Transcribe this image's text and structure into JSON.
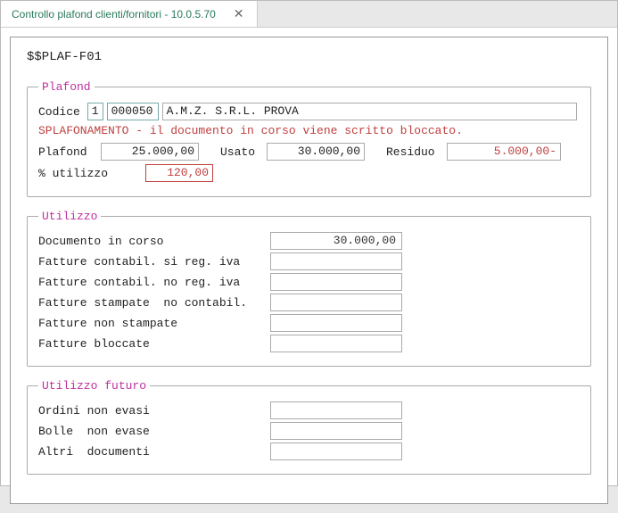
{
  "tab": {
    "title": "Controllo plafond clienti/fornitori   -   10.0.5.70",
    "close": "✕"
  },
  "form_id": "$$PLAF-F01",
  "plafond": {
    "legend": "Plafond",
    "codice_label": "Codice ",
    "codice_type": "1",
    "codice_num": "000050",
    "codice_name": "A.M.Z.  S.R.L.       PROVA",
    "warning": "SPLAFONAMENTO - il documento in corso viene scritto bloccato.",
    "plafond_label": "Plafond",
    "plafond_value": "25.000,00",
    "usato_label": "Usato",
    "usato_value": "30.000,00",
    "residuo_label": "Residuo",
    "residuo_value": "5.000,00-",
    "pct_label": "% utilizzo",
    "pct_value": "120,00"
  },
  "utilizzo": {
    "legend": "Utilizzo",
    "rows": [
      {
        "label": "Documento in corso",
        "value": "30.000,00"
      },
      {
        "label": "Fatture contabil. si reg. iva",
        "value": ""
      },
      {
        "label": "Fatture contabil. no reg. iva",
        "value": ""
      },
      {
        "label": "Fatture stampate  no contabil.",
        "value": ""
      },
      {
        "label": "Fatture non stampate",
        "value": ""
      },
      {
        "label": "Fatture bloccate",
        "value": ""
      }
    ]
  },
  "futuro": {
    "legend": "Utilizzo futuro",
    "rows": [
      {
        "label": "Ordini non evasi",
        "value": ""
      },
      {
        "label": "Bolle  non evase",
        "value": ""
      },
      {
        "label": "Altri  documenti",
        "value": ""
      }
    ]
  }
}
